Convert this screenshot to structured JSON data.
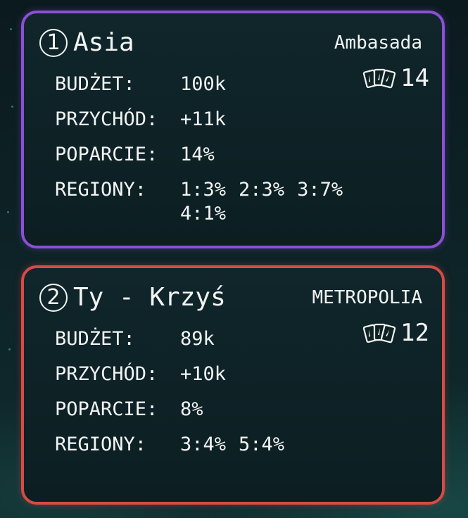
{
  "players": [
    {
      "number": "1",
      "name": "Asia",
      "building": "Ambasada",
      "card_count": "14",
      "border_color": "#8c4fd6",
      "stats": {
        "budget_label": "BUDŻET:",
        "budget": "100k",
        "income_label": "PRZYCHÓD:",
        "income": "+11k",
        "support_label": "POPARCIE:",
        "support": "14%",
        "regions_label": "REGIONY:",
        "regions": [
          "1:3%",
          "2:3%",
          "3:7%",
          "4:1%"
        ]
      }
    },
    {
      "number": "2",
      "name": "Ty - Krzyś",
      "building": "METROPOLIA",
      "card_count": "12",
      "border_color": "#d94a44",
      "stats": {
        "budget_label": "BUDŻET:",
        "budget": "89k",
        "income_label": "PRZYCHÓD:",
        "income": "+10k",
        "support_label": "POPARCIE:",
        "support": "8%",
        "regions_label": "REGIONY:",
        "regions": [
          "3:4%",
          "5:4%"
        ]
      }
    }
  ],
  "icons": {
    "cards": "cards-icon"
  }
}
